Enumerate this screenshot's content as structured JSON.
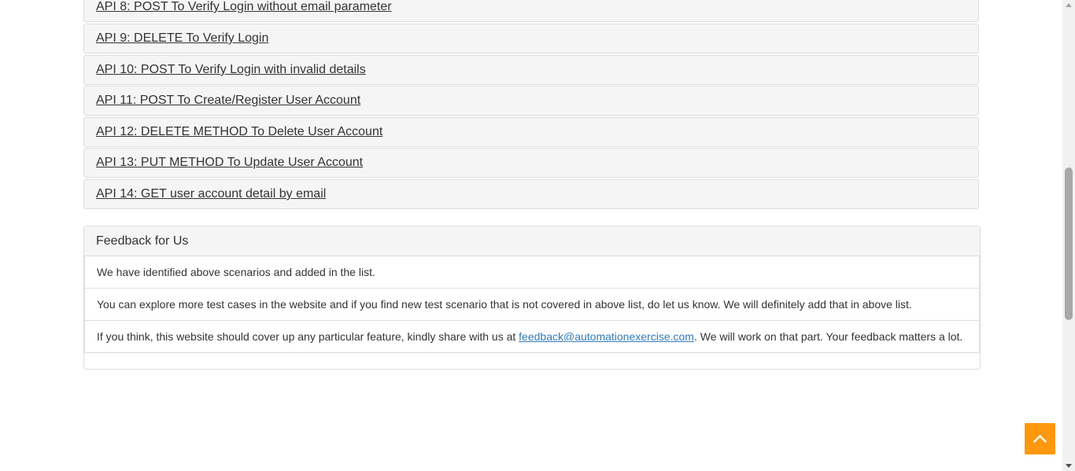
{
  "api_list": [
    {
      "label": "API 8: POST To Verify Login without email parameter"
    },
    {
      "label": "API 9: DELETE To Verify Login"
    },
    {
      "label": "API 10: POST To Verify Login with invalid details"
    },
    {
      "label": "API 11: POST To Create/Register User Account"
    },
    {
      "label": "API 12: DELETE METHOD To Delete User Account"
    },
    {
      "label": "API 13: PUT METHOD To Update User Account"
    },
    {
      "label": "API 14: GET user account detail by email"
    }
  ],
  "feedback": {
    "heading": "Feedback for Us",
    "line1": "We have identified above scenarios and added in the list.",
    "line2": "You can explore more test cases in the website and if you find new test scenario that is not covered in above list, do let us know. We will definitely add that in above list.",
    "line3_before": "If you think, this website should cover up any particular feature, kindly share with us at ",
    "line3_email": "feedback@automationexercise.com",
    "line3_after": ". We will work on that part. Your feedback matters a lot."
  },
  "icons": {
    "scroll_up": "chevron-up-icon"
  },
  "colors": {
    "accent": "#fe980f",
    "link": "#337ab7",
    "panel_bg": "#f5f5f5"
  }
}
